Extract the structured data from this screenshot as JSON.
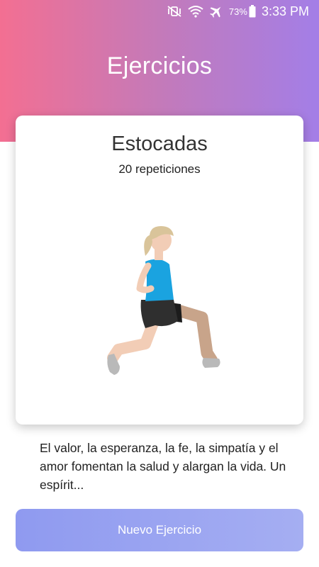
{
  "status_bar": {
    "icons": [
      "mute-vibrate-icon",
      "wifi-icon",
      "airplane-icon",
      "battery-icon"
    ],
    "battery_percent": "73%",
    "time": "3:33 PM"
  },
  "header": {
    "title": "Ejercicios",
    "gradient_colors": [
      "#f36f92",
      "#a37ee7"
    ]
  },
  "exercise": {
    "name": "Estocadas",
    "repetitions": "20 repeticiones",
    "illustration": "woman-lunge-illustration"
  },
  "description": "El valor, la esperanza, la fe, la simpatía y el amor fomentan la salud y alargan la vida. Un espírit...",
  "action": {
    "label": "Nuevo Ejercicio",
    "color": "#97a1f1"
  }
}
